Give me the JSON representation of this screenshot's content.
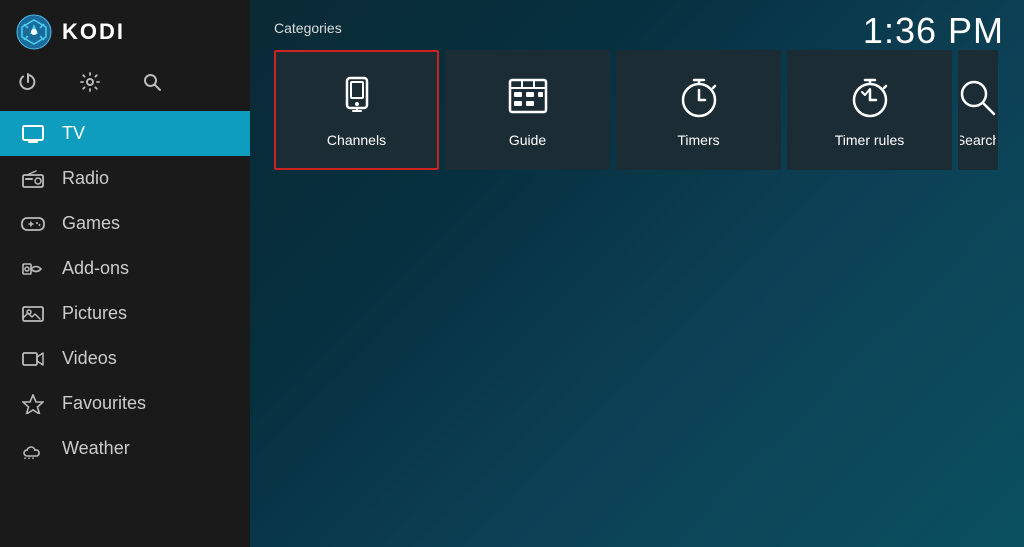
{
  "app": {
    "title": "KODI",
    "time": "1:36 PM"
  },
  "sidebar": {
    "nav_items": [
      {
        "id": "tv",
        "label": "TV",
        "icon": "tv",
        "active": true
      },
      {
        "id": "radio",
        "label": "Radio",
        "icon": "radio",
        "active": false
      },
      {
        "id": "games",
        "label": "Games",
        "icon": "games",
        "active": false
      },
      {
        "id": "add-ons",
        "label": "Add-ons",
        "icon": "addons",
        "active": false
      },
      {
        "id": "pictures",
        "label": "Pictures",
        "icon": "pictures",
        "active": false
      },
      {
        "id": "videos",
        "label": "Videos",
        "icon": "videos",
        "active": false
      },
      {
        "id": "favourites",
        "label": "Favourites",
        "icon": "favourites",
        "active": false
      },
      {
        "id": "weather",
        "label": "Weather",
        "icon": "weather",
        "active": false
      }
    ]
  },
  "main": {
    "categories_label": "Categories",
    "categories": [
      {
        "id": "channels",
        "label": "Channels",
        "selected": true
      },
      {
        "id": "guide",
        "label": "Guide",
        "selected": false
      },
      {
        "id": "timers",
        "label": "Timers",
        "selected": false
      },
      {
        "id": "timer-rules",
        "label": "Timer rules",
        "selected": false
      },
      {
        "id": "search",
        "label": "Search",
        "selected": false
      }
    ]
  },
  "controls": {
    "power_label": "power",
    "settings_label": "settings",
    "search_label": "search"
  }
}
